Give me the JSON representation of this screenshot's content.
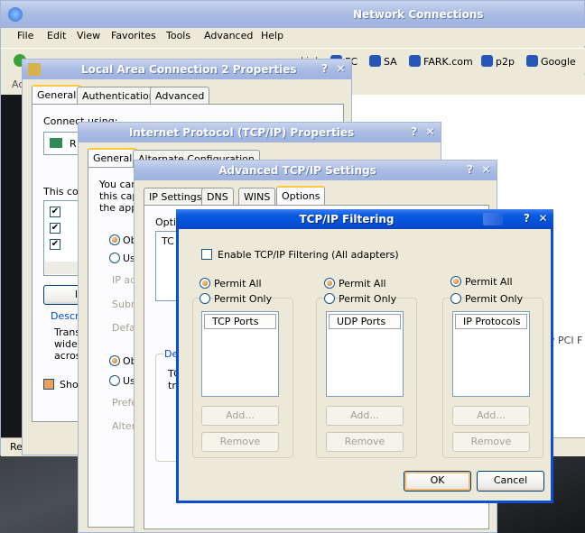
{
  "network_connections": {
    "title": "Network Connections",
    "menu": [
      "File",
      "Edit",
      "View",
      "Favorites",
      "Tools",
      "Advanced",
      "Help"
    ],
    "links_label": "Links",
    "links": [
      "FC",
      "SA",
      "FARK.com",
      "p2p",
      "Google"
    ],
    "side_text": "y PCI F",
    "partial_status": "Re",
    "partial_addr": "Ac"
  },
  "lac2": {
    "title": "Local Area Connection 2 Properties",
    "tabs": [
      "General",
      "Authentication",
      "Advanced"
    ],
    "connect_using": "Connect using:",
    "adapter": "R",
    "this_conn": "This con",
    "install": "In",
    "description": "Descri",
    "desc_lines": [
      "Trans",
      "wide",
      "acros"
    ],
    "show": "Show"
  },
  "tcpip": {
    "title": "Internet Protocol (TCP/IP) Properties",
    "tabs": [
      "General",
      "Alternate Configuration"
    ],
    "intro": [
      "You car",
      "this capa",
      "the appro"
    ],
    "obtain": "Ob",
    "use": "Us",
    "ip_addr": "IP ad",
    "subnet": "Subn",
    "gateway": "Defa",
    "obtain2": "Ob",
    "use2": "Us",
    "pref": "Prefe",
    "alt": "Alterr"
  },
  "adv": {
    "title": "Advanced TCP/IP Settings",
    "tabs": [
      "IP Settings",
      "DNS",
      "WINS",
      "Options"
    ],
    "optional": "Optic",
    "list_item": "TC",
    "desc": "De",
    "desc_lines": [
      "TC",
      "tra"
    ]
  },
  "filter": {
    "title": "TCP/IP Filtering",
    "enable_label": "Enable TCP/IP Filtering (All adapters)",
    "columns": [
      {
        "permit_all": "Permit All",
        "permit_only": "Permit Only",
        "header": "TCP Ports",
        "add": "Add...",
        "remove": "Remove"
      },
      {
        "permit_all": "Permit All",
        "permit_only": "Permit Only",
        "header": "UDP Ports",
        "add": "Add...",
        "remove": "Remove"
      },
      {
        "permit_all": "Permit All",
        "permit_only": "Permit Only",
        "header": "IP Protocols",
        "add": "Add...",
        "remove": "Remove"
      }
    ],
    "ok": "OK",
    "cancel": "Cancel"
  }
}
